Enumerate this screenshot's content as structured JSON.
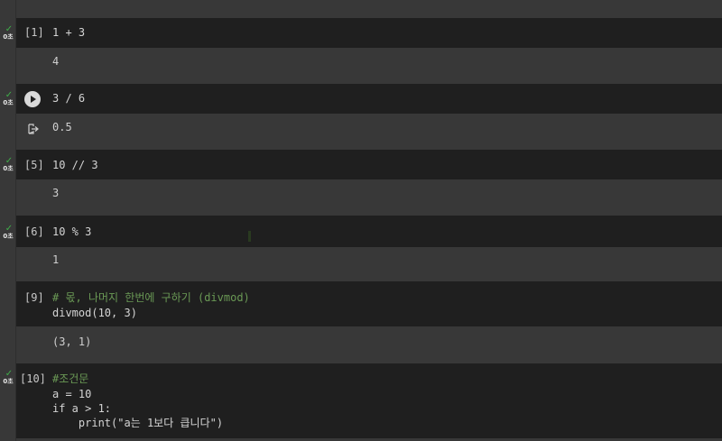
{
  "cells": [
    {
      "prompt": "[1]",
      "code": "1 + 3",
      "time": "0초",
      "output": "4"
    },
    {
      "prompt": "",
      "code": "3 / 6",
      "time": "0초",
      "output": "0.5"
    },
    {
      "prompt": "[5]",
      "code": "10 // 3",
      "time": "0초",
      "output": "3"
    },
    {
      "prompt": "[6]",
      "code": "10 % 3",
      "time": "0초",
      "output": "1"
    },
    {
      "prompt": "[9]",
      "code_line1": "# 몫, 나머지 한번에 구하기 (divmod)",
      "code_line2": "divmod(10, 3)",
      "output": "(3, 1)"
    },
    {
      "prompt": "[10]",
      "code_line1": "#조건문",
      "code_line2": "a = 10",
      "code_line3": "if a > 1:",
      "code_line4": "    print(\"a는 1보다 큽니다\")",
      "time": "0초"
    }
  ],
  "icons": {
    "run": "play-icon",
    "output": "output-redirect-icon",
    "status": "check-icon"
  },
  "colors": {
    "background": "#383838",
    "cell_background": "#1f1f1f",
    "check": "#3fae49",
    "comment": "#6a9955"
  }
}
